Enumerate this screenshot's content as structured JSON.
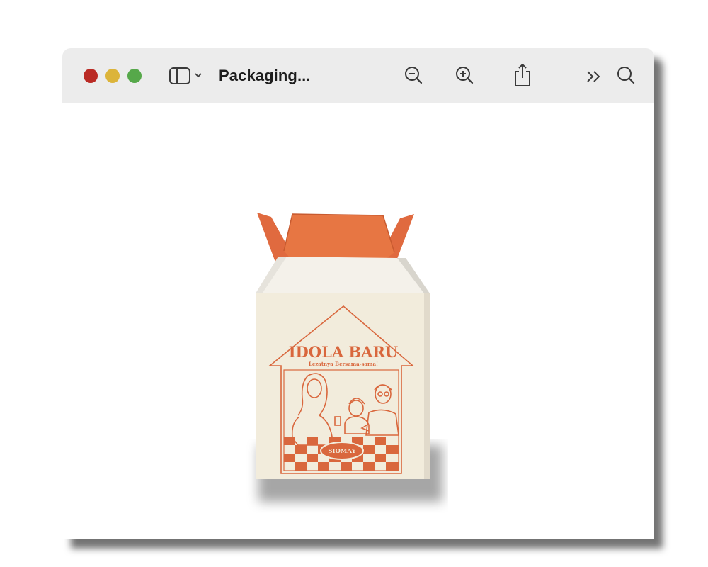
{
  "window": {
    "title": "Packaging...",
    "traffic_lights": [
      "close",
      "minimize",
      "maximize"
    ]
  },
  "toolbar": {
    "icons": [
      "sidebar-icon",
      "chevron-down-icon",
      "zoom-out-icon",
      "zoom-in-icon",
      "share-icon",
      "chevron-double-right-icon",
      "search-icon"
    ]
  },
  "document": {
    "image_description_none": "",
    "box": {
      "headline": "IDOLA BARU",
      "tagline": "Lezatnya Bersama-sama!",
      "product": "SIOMAY"
    }
  },
  "colors": {
    "accent": "#d9673d",
    "box_cream": "#f2ecdc",
    "titlebar": "#ececec"
  }
}
